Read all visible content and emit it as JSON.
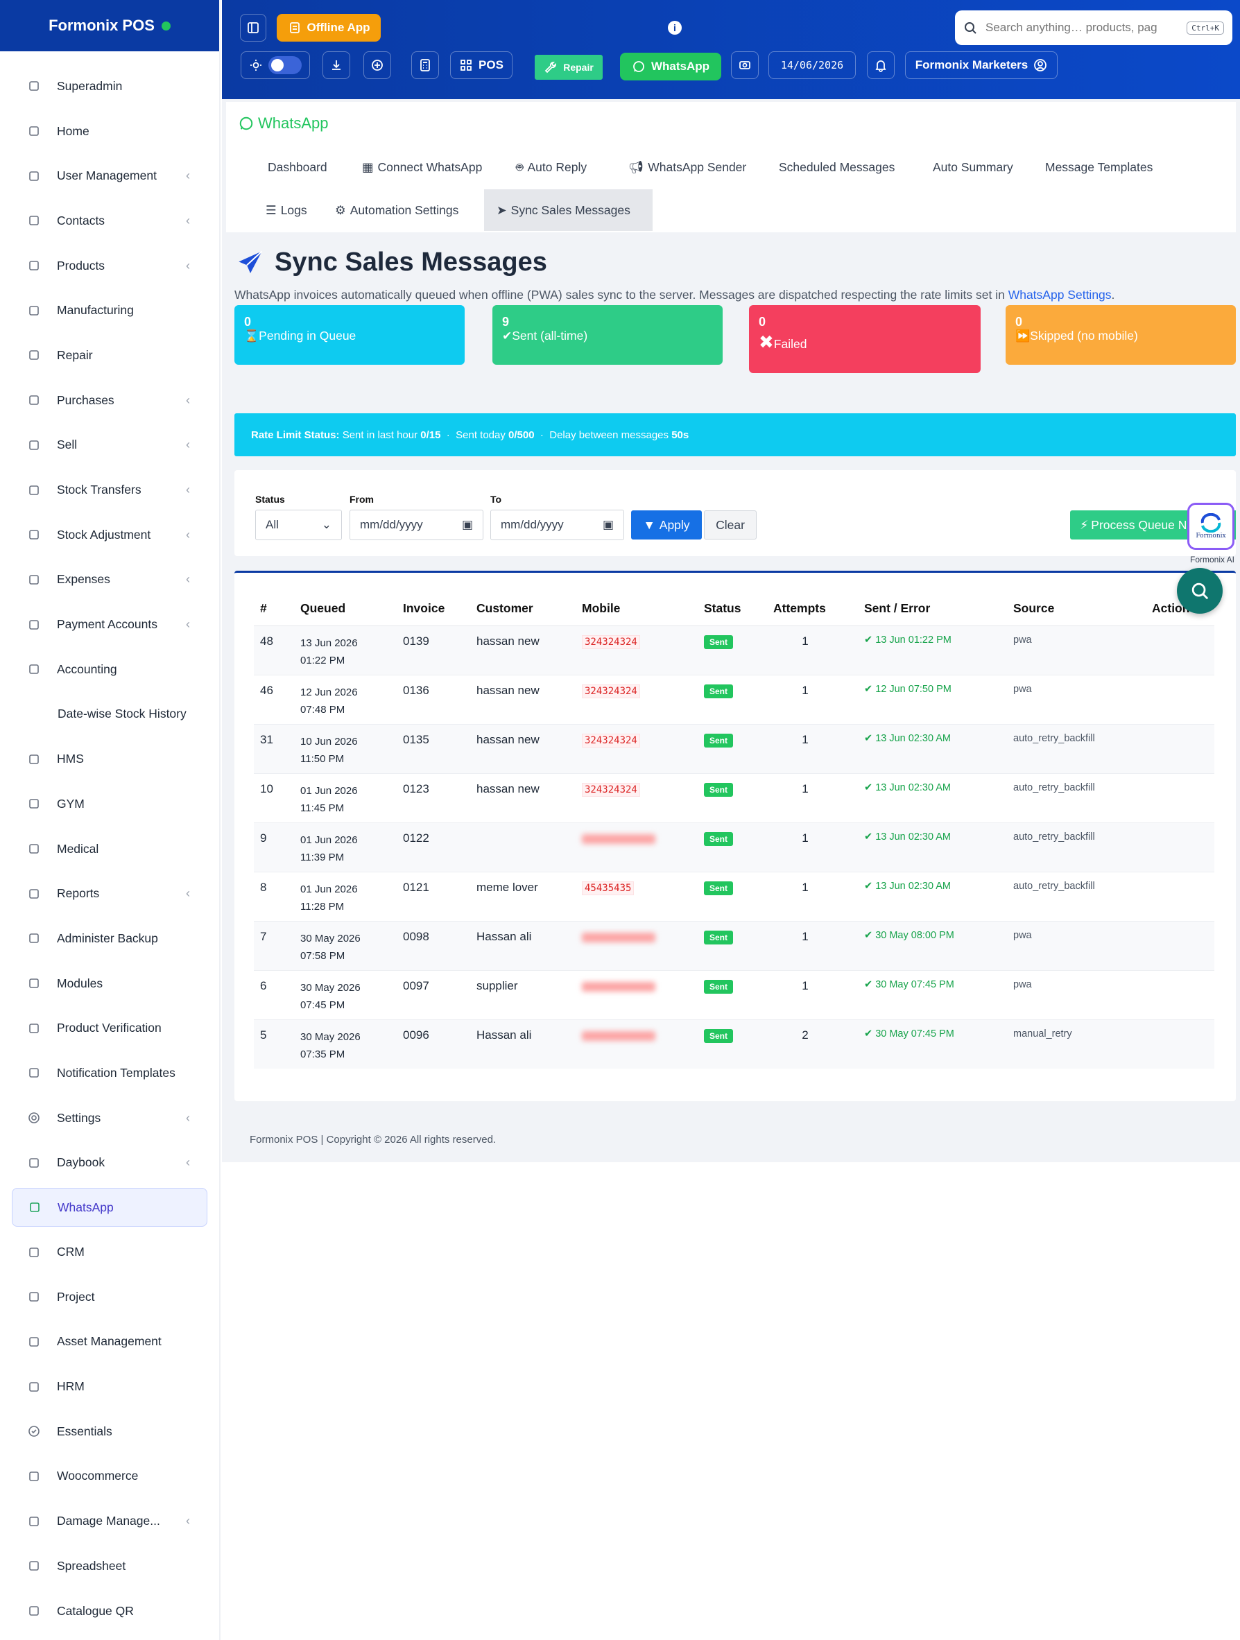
{
  "brand": {
    "name": "Formonix POS"
  },
  "sidebar": {
    "items": [
      {
        "label": "Superadmin",
        "icon": "user-shield-icon",
        "chevron": false
      },
      {
        "label": "Home",
        "icon": "home-icon",
        "chevron": false
      },
      {
        "label": "User Management",
        "icon": "users-icon",
        "chevron": true
      },
      {
        "label": "Contacts",
        "icon": "address-book-icon",
        "chevron": true
      },
      {
        "label": "Products",
        "icon": "cube-icon",
        "chevron": true
      },
      {
        "label": "Manufacturing",
        "icon": "industry-icon",
        "chevron": false
      },
      {
        "label": "Repair",
        "icon": "wrench-icon",
        "chevron": false
      },
      {
        "label": "Purchases",
        "icon": "download-icon",
        "chevron": true
      },
      {
        "label": "Sell",
        "icon": "upload-icon",
        "chevron": true
      },
      {
        "label": "Stock Transfers",
        "icon": "truck-icon",
        "chevron": true
      },
      {
        "label": "Stock Adjustment",
        "icon": "database-icon",
        "chevron": true
      },
      {
        "label": "Expenses",
        "icon": "receipt-icon",
        "chevron": true
      },
      {
        "label": "Payment Accounts",
        "icon": "credit-card-icon",
        "chevron": true
      },
      {
        "label": "Accounting",
        "icon": "bank-icon",
        "chevron": false
      },
      {
        "label": "Date-wise Stock History",
        "icon": "",
        "chevron": false
      },
      {
        "label": "HMS",
        "icon": "hotel-icon",
        "chevron": false
      },
      {
        "label": "GYM",
        "icon": "dumbbell-icon",
        "chevron": false
      },
      {
        "label": "Medical",
        "icon": "medical-icon",
        "chevron": false
      },
      {
        "label": "Reports",
        "icon": "clipboard-icon",
        "chevron": true
      },
      {
        "label": "Administer Backup",
        "icon": "cloud-icon",
        "chevron": false
      },
      {
        "label": "Modules",
        "icon": "layers-icon",
        "chevron": false
      },
      {
        "label": "Product Verification",
        "icon": "qrcode-icon",
        "chevron": false
      },
      {
        "label": "Notification Templates",
        "icon": "envelope-icon",
        "chevron": false
      },
      {
        "label": "Settings",
        "icon": "gear-icon",
        "chevron": true
      },
      {
        "label": "Daybook",
        "icon": "book-icon",
        "chevron": true
      },
      {
        "label": "WhatsApp",
        "icon": "whatsapp-icon",
        "chevron": false,
        "active": true
      },
      {
        "label": "CRM",
        "icon": "broadcast-icon",
        "chevron": false
      },
      {
        "label": "Project",
        "icon": "project-icon",
        "chevron": false
      },
      {
        "label": "Asset Management",
        "icon": "boxes-icon",
        "chevron": false
      },
      {
        "label": "HRM",
        "icon": "people-icon",
        "chevron": false
      },
      {
        "label": "Essentials",
        "icon": "check-circle-icon",
        "chevron": false
      },
      {
        "label": "Woocommerce",
        "icon": "wordpress-icon",
        "chevron": false
      },
      {
        "label": "Damage Manage...",
        "icon": "warning-icon",
        "chevron": true
      },
      {
        "label": "Spreadsheet",
        "icon": "file-excel-icon",
        "chevron": false
      },
      {
        "label": "Catalogue QR",
        "icon": "qrcode-icon",
        "chevron": false
      }
    ]
  },
  "header": {
    "offline_app": "Offline App",
    "pos": "POS",
    "repair": "Repair",
    "whatsapp": "WhatsApp",
    "date": "14/06/2026",
    "user": "Formonix Marketers",
    "search_placeholder": "Search anything… products, pag",
    "search_shortcut": "Ctrl+K"
  },
  "tabs": {
    "section_title": "WhatsApp",
    "items": [
      "Dashboard",
      "Connect WhatsApp",
      "Auto Reply",
      "WhatsApp Sender",
      "Scheduled Messages",
      "Auto Summary",
      "Message Templates",
      "Logs",
      "Automation Settings",
      "Sync Sales Messages"
    ]
  },
  "page": {
    "title": "Sync Sales Messages",
    "description": "WhatsApp invoices automatically queued when offline (PWA) sales sync to the server. Messages are dispatched respecting the rate limits set in",
    "description_link": "WhatsApp Settings",
    "description_end": "."
  },
  "stats": [
    {
      "value": "0",
      "label": "Pending in Queue",
      "color": "#0ecbf0"
    },
    {
      "value": "9",
      "label": "Sent (all-time)",
      "color": "#2ecc87"
    },
    {
      "value": "0",
      "label": "Failed",
      "color": "#f43f5e"
    },
    {
      "value": "0",
      "label": "Skipped (no mobile)",
      "color": "#fbaa3c"
    }
  ],
  "rate_limit": {
    "label": "Rate Limit Status:",
    "hour_text": "Sent in last hour",
    "hour_value": "0/15",
    "today_text": "Sent today",
    "today_value": "0/500",
    "delay_text": "Delay between messages",
    "delay_value": "50s"
  },
  "filters": {
    "status_label": "Status",
    "status_value": "All",
    "from_label": "From",
    "from_placeholder": "mm/dd/yyyy",
    "to_label": "To",
    "to_placeholder": "mm/dd/yyyy",
    "apply": "Apply",
    "clear": "Clear",
    "process_queue": "Process Queue N"
  },
  "assistant": {
    "label": "Formonix AI",
    "logo_text": "Formonix"
  },
  "table": {
    "columns": [
      "#",
      "Queued",
      "Invoice",
      "Customer",
      "Mobile",
      "Status",
      "Attempts",
      "Sent / Error",
      "Source",
      "Action"
    ],
    "rows": [
      {
        "id": "48",
        "date": "13 Jun 2026",
        "time": "01:22 PM",
        "invoice": "0139",
        "customer": "hassan new",
        "mobile": "324324324",
        "mobile_hidden": false,
        "status": "Sent",
        "attempts": "1",
        "sent": "13 Jun 01:22 PM",
        "source": "pwa"
      },
      {
        "id": "46",
        "date": "12 Jun 2026",
        "time": "07:48 PM",
        "invoice": "0136",
        "customer": "hassan new",
        "mobile": "324324324",
        "mobile_hidden": false,
        "status": "Sent",
        "attempts": "1",
        "sent": "12 Jun 07:50 PM",
        "source": "pwa"
      },
      {
        "id": "31",
        "date": "10 Jun 2026",
        "time": "11:50 PM",
        "invoice": "0135",
        "customer": "hassan new",
        "mobile": "324324324",
        "mobile_hidden": false,
        "status": "Sent",
        "attempts": "1",
        "sent": "13 Jun 02:30 AM",
        "source": "auto_retry_backfill"
      },
      {
        "id": "10",
        "date": "01 Jun 2026",
        "time": "11:45 PM",
        "invoice": "0123",
        "customer": "hassan new",
        "mobile": "324324324",
        "mobile_hidden": false,
        "status": "Sent",
        "attempts": "1",
        "sent": "13 Jun 02:30 AM",
        "source": "auto_retry_backfill"
      },
      {
        "id": "9",
        "date": "01 Jun 2026",
        "time": "11:39 PM",
        "invoice": "0122",
        "customer": "",
        "mobile": "",
        "mobile_hidden": true,
        "status": "Sent",
        "attempts": "1",
        "sent": "13 Jun 02:30 AM",
        "source": "auto_retry_backfill"
      },
      {
        "id": "8",
        "date": "01 Jun 2026",
        "time": "11:28 PM",
        "invoice": "0121",
        "customer": "meme lover",
        "mobile": "45435435",
        "mobile_hidden": false,
        "status": "Sent",
        "attempts": "1",
        "sent": "13 Jun 02:30 AM",
        "source": "auto_retry_backfill"
      },
      {
        "id": "7",
        "date": "30 May 2026",
        "time": "07:58 PM",
        "invoice": "0098",
        "customer": "Hassan ali",
        "mobile": "",
        "mobile_hidden": true,
        "status": "Sent",
        "attempts": "1",
        "sent": "30 May 08:00 PM",
        "source": "pwa"
      },
      {
        "id": "6",
        "date": "30 May 2026",
        "time": "07:45 PM",
        "invoice": "0097",
        "customer": "supplier",
        "mobile": "",
        "mobile_hidden": true,
        "status": "Sent",
        "attempts": "1",
        "sent": "30 May 07:45 PM",
        "source": "pwa"
      },
      {
        "id": "5",
        "date": "30 May 2026",
        "time": "07:35 PM",
        "invoice": "0096",
        "customer": "Hassan ali",
        "mobile": "",
        "mobile_hidden": true,
        "status": "Sent",
        "attempts": "2",
        "sent": "30 May 07:45 PM",
        "source": "manual_retry"
      }
    ]
  },
  "footer": {
    "text": "Formonix POS | Copyright © 2026 All rights reserved."
  }
}
